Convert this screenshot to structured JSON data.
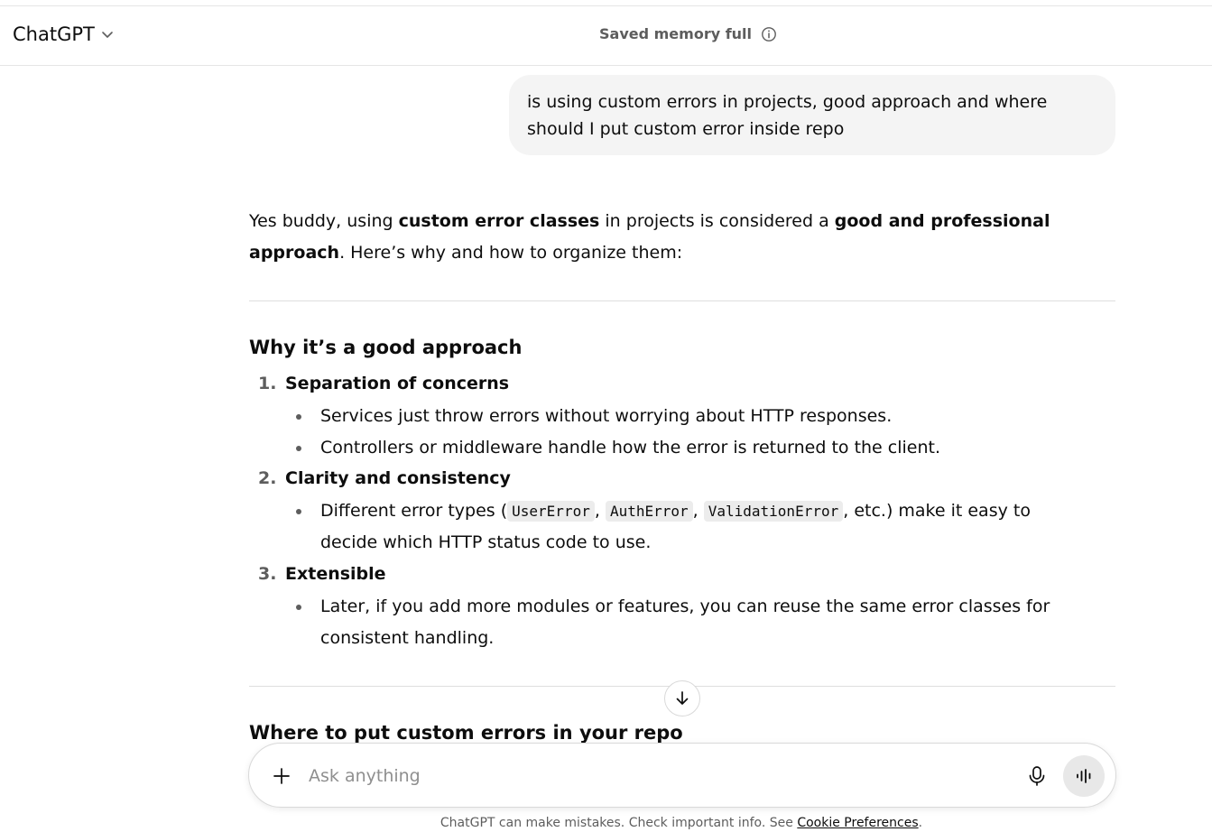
{
  "header": {
    "model_label": "ChatGPT",
    "memory_status": "Saved memory full"
  },
  "user_message": "is using custom errors in projects, good approach and where should I put custom error inside repo",
  "answer": {
    "intro_parts": [
      "Yes buddy, using ",
      "custom error classes",
      " in projects is considered a ",
      "good and professional approach",
      ". Here’s why and how to organize them:"
    ],
    "section1_title": "Why it’s a good approach",
    "items": [
      {
        "num": "1.",
        "title": "Separation of concerns",
        "bullets": [
          "Services just throw errors without worrying about HTTP responses.",
          "Controllers or middleware handle how the error is returned to the client."
        ]
      },
      {
        "num": "2.",
        "title": "Clarity and consistency",
        "bullet_parts": [
          "Different error types (",
          "UserError",
          ", ",
          "AuthError",
          ", ",
          "ValidationError",
          ", etc.) make it easy to decide which HTTP status code to use."
        ]
      },
      {
        "num": "3.",
        "title": "Extensible",
        "bullets": [
          "Later, if you add more modules or features, you can reuse the same error classes for consistent handling."
        ]
      }
    ],
    "section2_title": "Where to put custom errors in your repo"
  },
  "composer": {
    "placeholder": "Ask anything"
  },
  "footer": {
    "text": "ChatGPT can make mistakes. Check important info. See ",
    "link": "Cookie Preferences",
    "end": "."
  },
  "icons": {
    "model": "chevron-down-icon",
    "memory": "info-icon",
    "scroll": "arrow-down-icon",
    "attach": "plus-icon",
    "dictate": "microphone-icon",
    "voice": "voice-mode-icon"
  }
}
